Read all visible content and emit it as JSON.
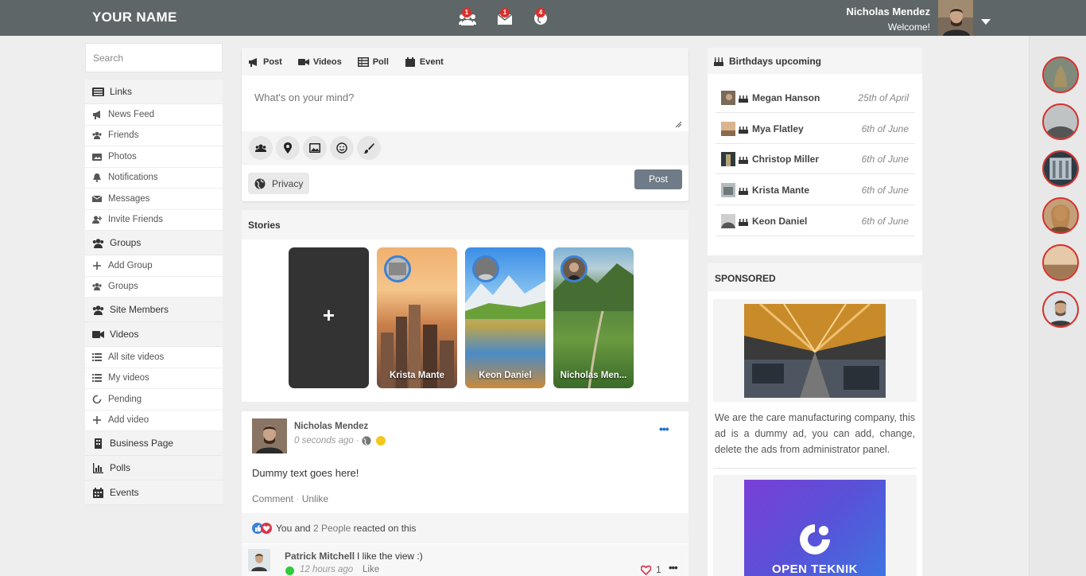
{
  "topbar": {
    "brand": "YOUR NAME",
    "notifications": [
      {
        "icon": "friends-icon",
        "count": "1"
      },
      {
        "icon": "mail-icon",
        "count": "1"
      },
      {
        "icon": "globe-icon",
        "count": "4"
      }
    ],
    "user_name": "Nicholas Mendez",
    "welcome": "Welcome!"
  },
  "sidebar": {
    "search_placeholder": "Search",
    "sections": [
      {
        "label": "Links",
        "icon": "links-icon",
        "items": [
          {
            "label": "News Feed",
            "icon": "megaphone-icon"
          },
          {
            "label": "Friends",
            "icon": "friends-icon"
          },
          {
            "label": "Photos",
            "icon": "photo-icon"
          },
          {
            "label": "Notifications",
            "icon": "bell-icon"
          },
          {
            "label": "Messages",
            "icon": "envelope-icon"
          },
          {
            "label": "Invite Friends",
            "icon": "user-plus-icon"
          }
        ]
      },
      {
        "label": "Groups",
        "icon": "users-icon",
        "items": [
          {
            "label": "Add Group",
            "icon": "plus-icon"
          },
          {
            "label": "Groups",
            "icon": "users-icon"
          }
        ]
      },
      {
        "label": "Site Members",
        "icon": "users-icon",
        "items": []
      },
      {
        "label": "Videos",
        "icon": "video-icon",
        "items": [
          {
            "label": "All site videos",
            "icon": "list-icon"
          },
          {
            "label": "My videos",
            "icon": "list-icon"
          },
          {
            "label": "Pending",
            "icon": "circle-icon"
          },
          {
            "label": "Add video",
            "icon": "plus-icon"
          }
        ]
      },
      {
        "label": "Business Page",
        "icon": "building-icon",
        "items": []
      },
      {
        "label": "Polls",
        "icon": "chart-icon",
        "items": []
      },
      {
        "label": "Events",
        "icon": "calendar-icon",
        "items": []
      }
    ]
  },
  "composer": {
    "tabs": [
      "Post",
      "Videos",
      "Poll",
      "Event"
    ],
    "placeholder": "What's on your mind?",
    "privacy": "Privacy",
    "post_button": "Post"
  },
  "stories": {
    "title": "Stories",
    "add_label": "+",
    "items": [
      "Krista Mante",
      "Keon Daniel",
      "Nicholas Men..."
    ]
  },
  "post": {
    "author": "Nicholas Mendez",
    "time": "0 seconds ago",
    "separator": "·",
    "more": "•••",
    "text": "Dummy text goes here!",
    "comment": "Comment",
    "unlike": "Unlike",
    "reaction_you": "You and",
    "reaction_people": "2 People",
    "reaction_suffix": "reacted on this",
    "comment_author": "Patrick Mitchell",
    "comment_text": "I like the view :)",
    "comment_time": "12 hours ago",
    "comment_like": "Like",
    "comment_likes": "1"
  },
  "birthdays": {
    "title": "Birthdays upcoming",
    "items": [
      {
        "name": "Megan Hanson",
        "date": "25th of April"
      },
      {
        "name": "Mya Flatley",
        "date": "6th of June"
      },
      {
        "name": "Christop Miller",
        "date": "6th of June"
      },
      {
        "name": "Krista Mante",
        "date": "6th of June"
      },
      {
        "name": "Keon Daniel",
        "date": "6th of June"
      }
    ]
  },
  "sponsored": {
    "title": "SPONSORED",
    "ad1_text": "We are the care manufacturing company, this ad is a dummy ad, you can add, change, delete the ads from administrator panel.",
    "ad2_label": "OPEN TEKNIK"
  },
  "colors": {
    "topbar": "#5f6668",
    "accent": "#1f6fd4",
    "badge": "#d9302c",
    "post_button": "#6f7b86"
  }
}
